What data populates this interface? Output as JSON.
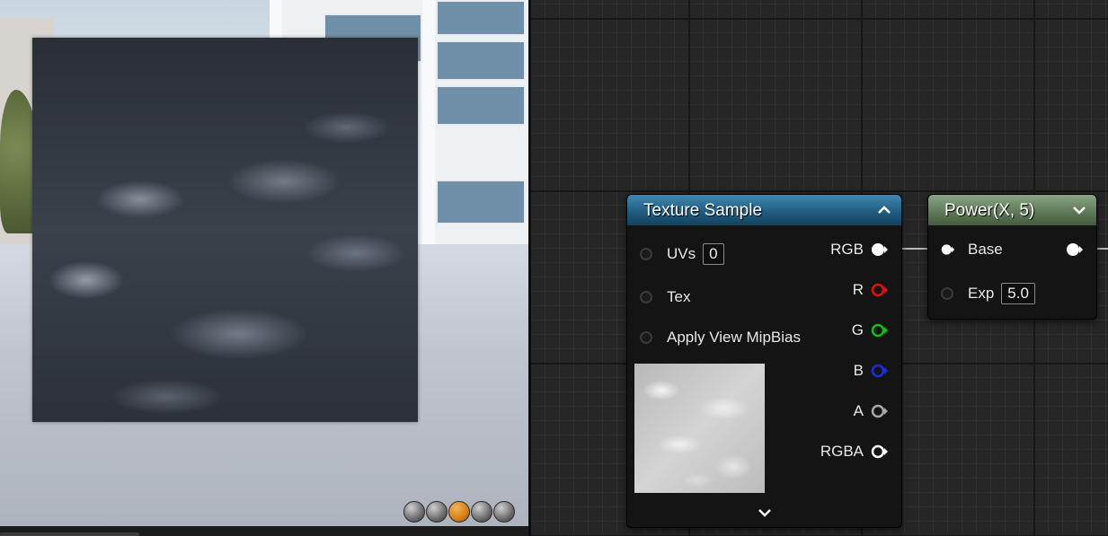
{
  "viewport": {
    "controls": [
      {
        "name": "cylinder",
        "active": false
      },
      {
        "name": "sphere",
        "active": false
      },
      {
        "name": "plane",
        "active": true
      },
      {
        "name": "cube",
        "active": false
      },
      {
        "name": "custom-mesh",
        "active": false
      }
    ]
  },
  "texture_sample": {
    "title": "Texture Sample",
    "inputs": [
      {
        "label": "UVs",
        "value": "0"
      },
      {
        "label": "Tex"
      },
      {
        "label": "Apply View MipBias"
      }
    ],
    "outputs": [
      {
        "label": "RGB",
        "color": "#ffffff"
      },
      {
        "label": "R",
        "color": "#e01010"
      },
      {
        "label": "G",
        "color": "#12c012"
      },
      {
        "label": "B",
        "color": "#1a2ee0"
      },
      {
        "label": "A",
        "color": "#a8a8a8"
      },
      {
        "label": "RGBA",
        "color": "#ffffff"
      }
    ]
  },
  "power_node": {
    "title": "Power(X, 5)",
    "inputs": [
      {
        "label": "Base"
      },
      {
        "label": "Exp",
        "value": "5.0"
      }
    ]
  },
  "colors": {
    "texture_header": "#1f5a7e",
    "power_header": "#5c7755",
    "active_view_button": "#d47f12"
  }
}
